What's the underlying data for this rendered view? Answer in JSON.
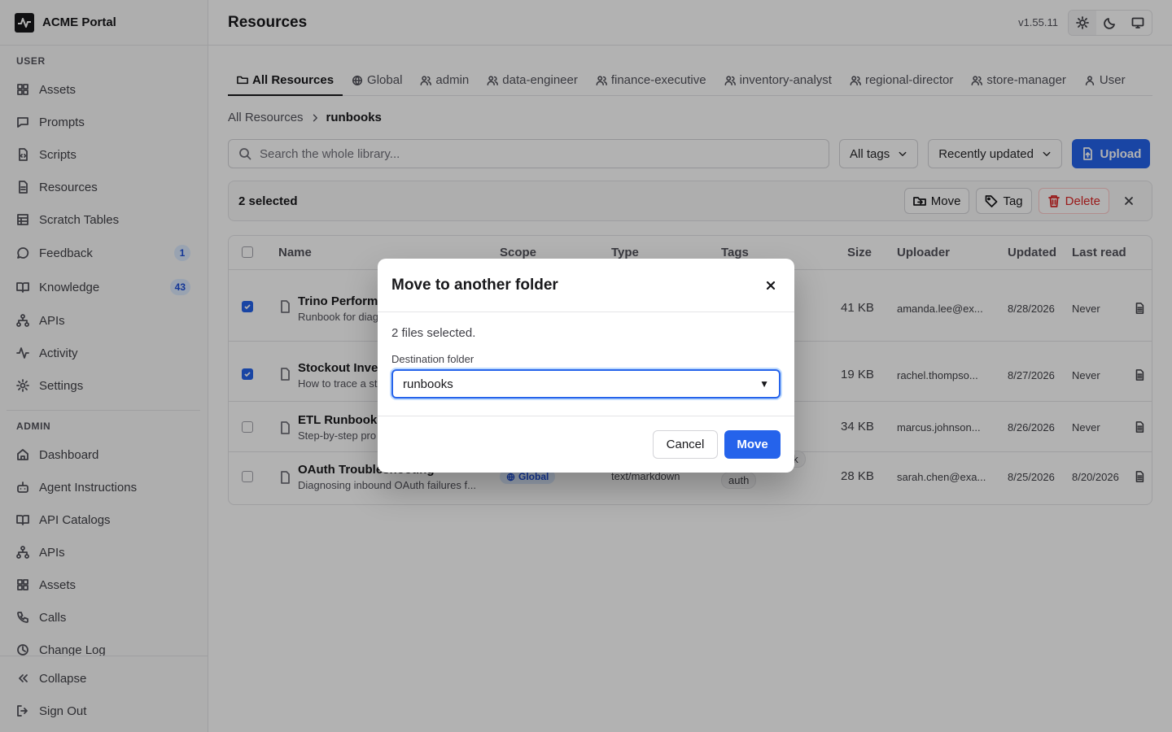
{
  "app": {
    "name": "ACME Portal"
  },
  "sidebar": {
    "user_label": "USER",
    "user_items": [
      {
        "label": "Assets",
        "icon": "grid-icon"
      },
      {
        "label": "Prompts",
        "icon": "message-icon"
      },
      {
        "label": "Scripts",
        "icon": "code-file-icon"
      },
      {
        "label": "Resources",
        "icon": "file-icon"
      },
      {
        "label": "Scratch Tables",
        "icon": "table-icon"
      },
      {
        "label": "Feedback",
        "icon": "chat-icon",
        "badge": "1"
      },
      {
        "label": "Knowledge",
        "icon": "book-icon",
        "badge": "43"
      },
      {
        "label": "APIs",
        "icon": "network-icon"
      },
      {
        "label": "Activity",
        "icon": "activity-icon"
      },
      {
        "label": "Settings",
        "icon": "gear-icon"
      }
    ],
    "admin_label": "ADMIN",
    "admin_items": [
      {
        "label": "Dashboard",
        "icon": "home-icon"
      },
      {
        "label": "Agent Instructions",
        "icon": "bot-icon"
      },
      {
        "label": "API Catalogs",
        "icon": "book-icon"
      },
      {
        "label": "APIs",
        "icon": "network-icon"
      },
      {
        "label": "Assets",
        "icon": "grid-icon"
      },
      {
        "label": "Calls",
        "icon": "phone-icon"
      },
      {
        "label": "Change Log",
        "icon": "clock-icon"
      }
    ],
    "collapse_label": "Collapse",
    "signout_label": "Sign Out"
  },
  "header": {
    "title": "Resources",
    "version": "v1.55.11"
  },
  "tabs": [
    {
      "label": "All Resources",
      "icon": "folder-icon",
      "active": true
    },
    {
      "label": "Global",
      "icon": "globe-icon"
    },
    {
      "label": "admin",
      "icon": "users-icon"
    },
    {
      "label": "data-engineer",
      "icon": "users-icon"
    },
    {
      "label": "finance-executive",
      "icon": "users-icon"
    },
    {
      "label": "inventory-analyst",
      "icon": "users-icon"
    },
    {
      "label": "regional-director",
      "icon": "users-icon"
    },
    {
      "label": "store-manager",
      "icon": "users-icon"
    },
    {
      "label": "User",
      "icon": "user-icon"
    }
  ],
  "breadcrumb": {
    "root": "All Resources",
    "current": "runbooks"
  },
  "toolbar": {
    "search_placeholder": "Search the whole library...",
    "tags_filter": "All tags",
    "sort": "Recently updated",
    "upload_label": "Upload"
  },
  "selection": {
    "count_label": "2 selected",
    "move_label": "Move",
    "tag_label": "Tag",
    "delete_label": "Delete"
  },
  "table": {
    "headers": {
      "name": "Name",
      "scope": "Scope",
      "type": "Type",
      "tags": "Tags",
      "size": "Size",
      "uploader": "Uploader",
      "updated": "Updated",
      "last_read": "Last read"
    },
    "rows": [
      {
        "checked": true,
        "name": "Trino Performa",
        "desc": "Runbook for diag",
        "size": "41 KB",
        "uploader": "amanda.lee@ex...",
        "updated": "8/28/2026",
        "last_read": "Never"
      },
      {
        "checked": true,
        "name": "Stockout Inves",
        "desc": "How to trace a st",
        "size": "19 KB",
        "uploader": "rachel.thompso...",
        "updated": "8/27/2026",
        "last_read": "Never"
      },
      {
        "checked": false,
        "name": "ETL Runbook",
        "desc": "Step-by-step pro",
        "size": "34 KB",
        "uploader": "marcus.johnson...",
        "updated": "8/26/2026",
        "last_read": "Never"
      },
      {
        "checked": false,
        "name": "OAuth Troubleshooting",
        "desc": "Diagnosing inbound OAuth failures f...",
        "scope": "Global",
        "type": "text/markdown",
        "tags": [
          "ok",
          "auth"
        ],
        "size": "28 KB",
        "uploader": "sarah.chen@exa...",
        "updated": "8/25/2026",
        "last_read": "8/20/2026"
      }
    ]
  },
  "modal": {
    "title": "Move to another folder",
    "info": "2 files selected.",
    "field_label": "Destination folder",
    "selected_folder": "runbooks",
    "cancel_label": "Cancel",
    "confirm_label": "Move"
  },
  "colors": {
    "accent": "#2563eb",
    "danger": "#dc2626"
  }
}
